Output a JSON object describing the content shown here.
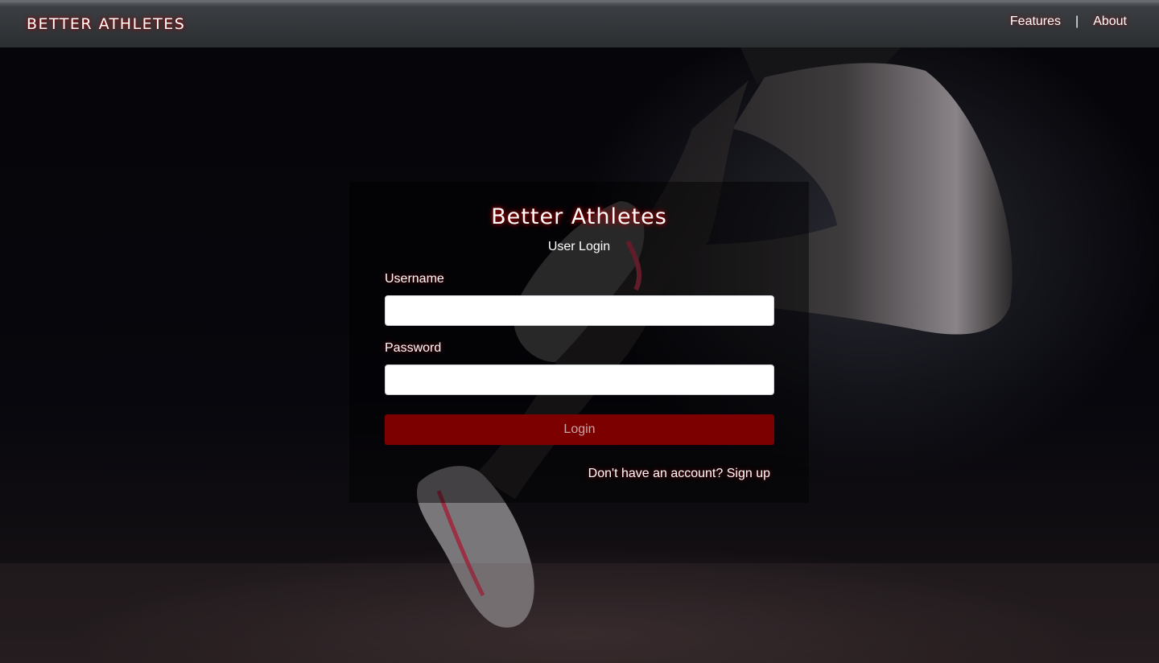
{
  "navbar": {
    "brand": "Better Athletes",
    "links": [
      {
        "label": "Features"
      },
      {
        "label": "About"
      }
    ],
    "separator": "|"
  },
  "login": {
    "title": "Better Athletes",
    "subtitle": "User Login",
    "username_label": "Username",
    "username_value": "",
    "password_label": "Password",
    "password_value": "",
    "submit_label": "Login",
    "signup_prompt": "Don't have an account?",
    "signup_link": "Sign up"
  },
  "colors": {
    "accent": "#7d0000",
    "navbar": "#2b2e31",
    "background": "#05050a"
  }
}
